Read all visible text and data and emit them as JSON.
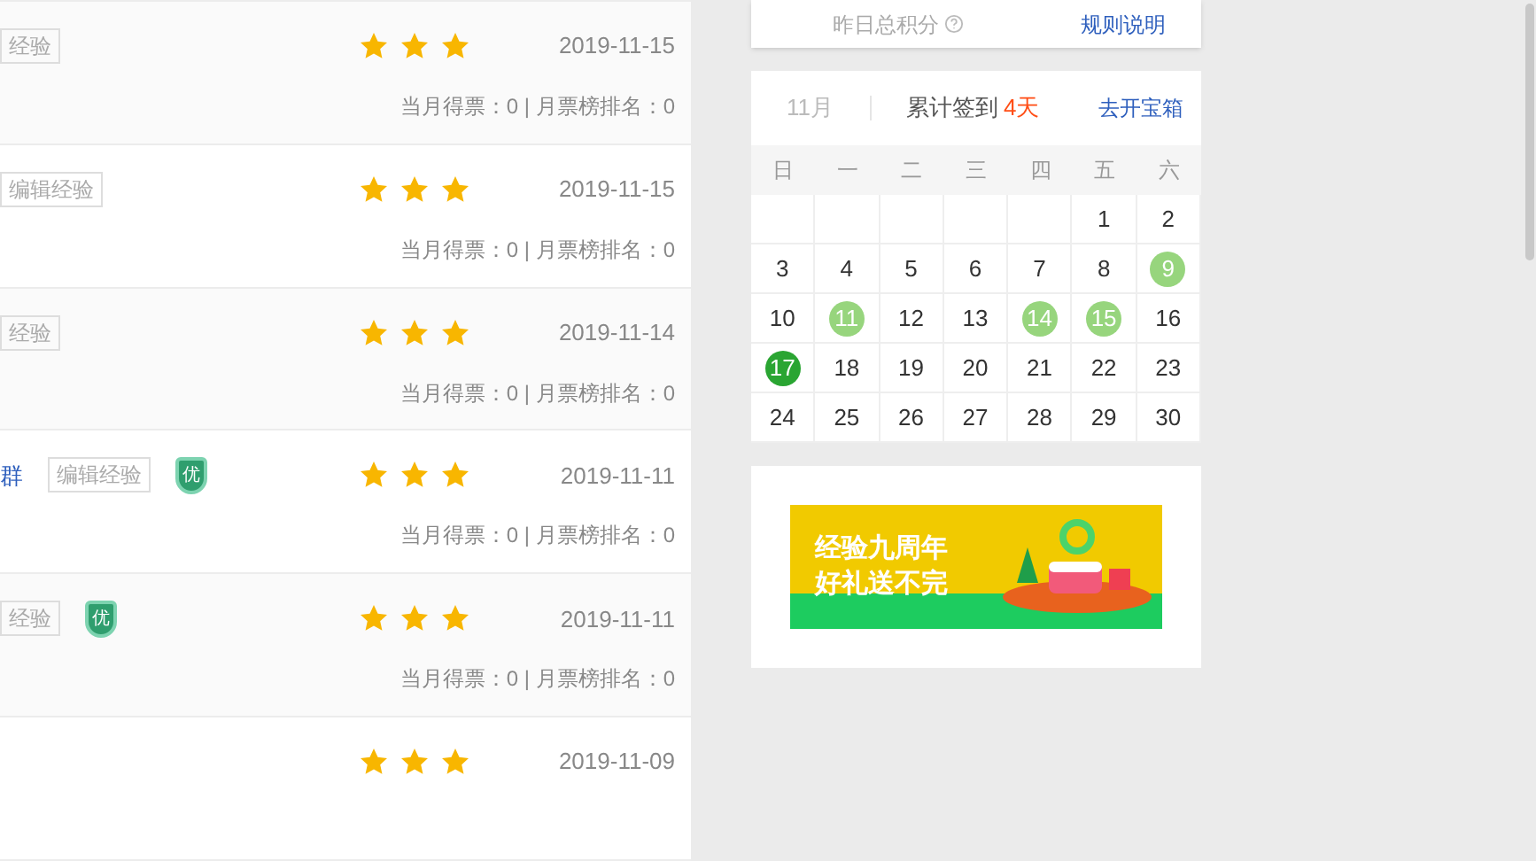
{
  "experiences": [
    {
      "tag": "经验",
      "stars": 3,
      "date": "2019-11-15",
      "stats": "当月得票：0 | 月票榜排名：0"
    },
    {
      "tag": "编辑经验",
      "stars": 3,
      "date": "2019-11-15",
      "stats": "当月得票：0 | 月票榜排名：0"
    },
    {
      "tag": "经验",
      "stars": 3,
      "date": "2019-11-14",
      "stats": "当月得票：0 | 月票榜排名：0"
    },
    {
      "title": "群",
      "tag": "编辑经验",
      "badge": "优",
      "stars": 3,
      "date": "2019-11-11",
      "stats": "当月得票：0 | 月票榜排名：0"
    },
    {
      "tag": "经验",
      "badge": "优",
      "stars": 3,
      "date": "2019-11-11",
      "stats": "当月得票：0 | 月票榜排名：0"
    },
    {
      "stars": 3,
      "date": "2019-11-09"
    }
  ],
  "points_card": {
    "label": "昨日总积分",
    "link": "规则说明"
  },
  "calendar": {
    "month": "11月",
    "signin_label": "累计签到",
    "signin_count": "4天",
    "link": "去开宝箱",
    "weekdays": [
      "日",
      "一",
      "二",
      "三",
      "四",
      "五",
      "六"
    ],
    "weeks": [
      [
        {
          "kind": "blank"
        },
        {
          "kind": "blank"
        },
        {
          "kind": "blank"
        },
        {
          "kind": "blank"
        },
        {
          "kind": "blank"
        },
        {
          "kind": "normal",
          "label": "1"
        },
        {
          "kind": "normal",
          "label": "2"
        }
      ],
      [
        {
          "kind": "normal",
          "label": "3"
        },
        {
          "kind": "normal",
          "label": "4"
        },
        {
          "kind": "normal",
          "label": "5"
        },
        {
          "kind": "normal",
          "label": "6"
        },
        {
          "kind": "normal",
          "label": "7"
        },
        {
          "kind": "normal",
          "label": "8"
        },
        {
          "kind": "signed",
          "label": "9"
        }
      ],
      [
        {
          "kind": "normal",
          "label": "10"
        },
        {
          "kind": "signed",
          "label": "11"
        },
        {
          "kind": "normal",
          "label": "12"
        },
        {
          "kind": "normal",
          "label": "13"
        },
        {
          "kind": "signed",
          "label": "14"
        },
        {
          "kind": "signed",
          "label": "15"
        },
        {
          "kind": "normal",
          "label": "16"
        }
      ],
      [
        {
          "kind": "today",
          "label": "17"
        },
        {
          "kind": "normal",
          "label": "18"
        },
        {
          "kind": "normal",
          "label": "19"
        },
        {
          "kind": "normal",
          "label": "20"
        },
        {
          "kind": "normal",
          "label": "21"
        },
        {
          "kind": "normal",
          "label": "22"
        },
        {
          "kind": "normal",
          "label": "23"
        }
      ],
      [
        {
          "kind": "normal",
          "label": "24"
        },
        {
          "kind": "normal",
          "label": "25"
        },
        {
          "kind": "normal",
          "label": "26"
        },
        {
          "kind": "normal",
          "label": "27"
        },
        {
          "kind": "normal",
          "label": "28"
        },
        {
          "kind": "normal",
          "label": "29"
        },
        {
          "kind": "normal",
          "label": "30"
        }
      ]
    ]
  },
  "banner": {
    "lines": [
      "经验九周年",
      "好礼送不完"
    ]
  }
}
